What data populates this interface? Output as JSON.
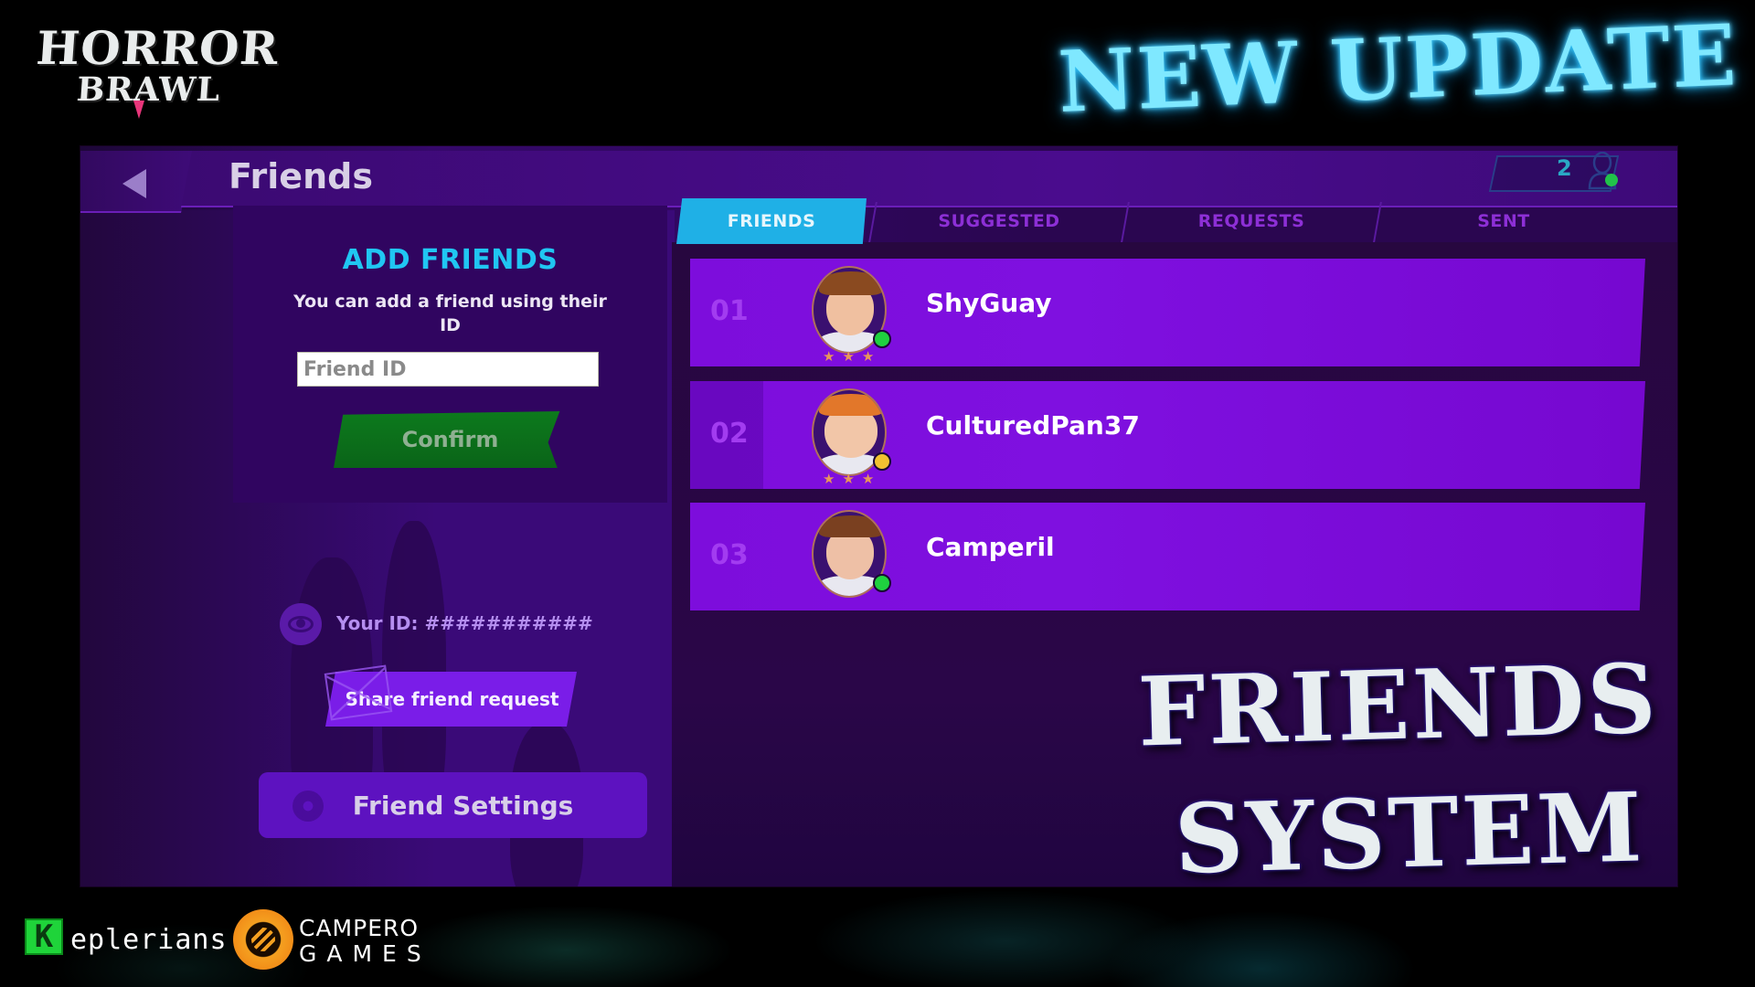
{
  "branding": {
    "game_logo_line1": "HORROR",
    "game_logo_line2": "BRAWL",
    "headline": "NEW UPDATE",
    "feature_title_line1": "FRIENDS",
    "feature_title_line2": "SYSTEM",
    "partner_logos": [
      {
        "name": "Keplerians",
        "mark": "K",
        "text": "eplerians"
      },
      {
        "name": "Campero Games",
        "line1": "CAMPERO",
        "line2": "GAMES"
      }
    ]
  },
  "header": {
    "back_icon": "back-arrow-icon",
    "title": "Friends",
    "online_count": "2",
    "online_icon": "person-online-icon"
  },
  "add_friends": {
    "title": "ADD FRIENDS",
    "description": "You can add a friend using their ID",
    "input_value": "",
    "input_placeholder": "Friend ID",
    "confirm_label": "Confirm"
  },
  "your_id": {
    "icon": "eye-icon",
    "label": "Your ID: ###########"
  },
  "share_button": {
    "icon": "envelope-icon",
    "label": "Share friend request"
  },
  "settings_button": {
    "icon": "gear-icon",
    "label": "Friend Settings"
  },
  "tabs": [
    {
      "label": "FRIENDS",
      "active": true
    },
    {
      "label": "SUGGESTED",
      "active": false
    },
    {
      "label": "REQUESTS",
      "active": false
    },
    {
      "label": "SENT",
      "active": false
    }
  ],
  "friends": [
    {
      "rank": "01",
      "name": "ShyGuay",
      "status": "online",
      "status_color": "#1fd13f",
      "stars": 3
    },
    {
      "rank": "02",
      "name": "CulturedPan37",
      "status": "away",
      "status_color": "#f2c230",
      "stars": 3
    },
    {
      "rank": "03",
      "name": "Camperil",
      "status": "online",
      "status_color": "#1fd13f",
      "stars": 0
    }
  ],
  "colors": {
    "accent_cyan": "#1fb0e6",
    "row_purple": "#7f10e0",
    "confirm_green": "#0d7a1d",
    "headline_glow": "#7fe8ff"
  }
}
